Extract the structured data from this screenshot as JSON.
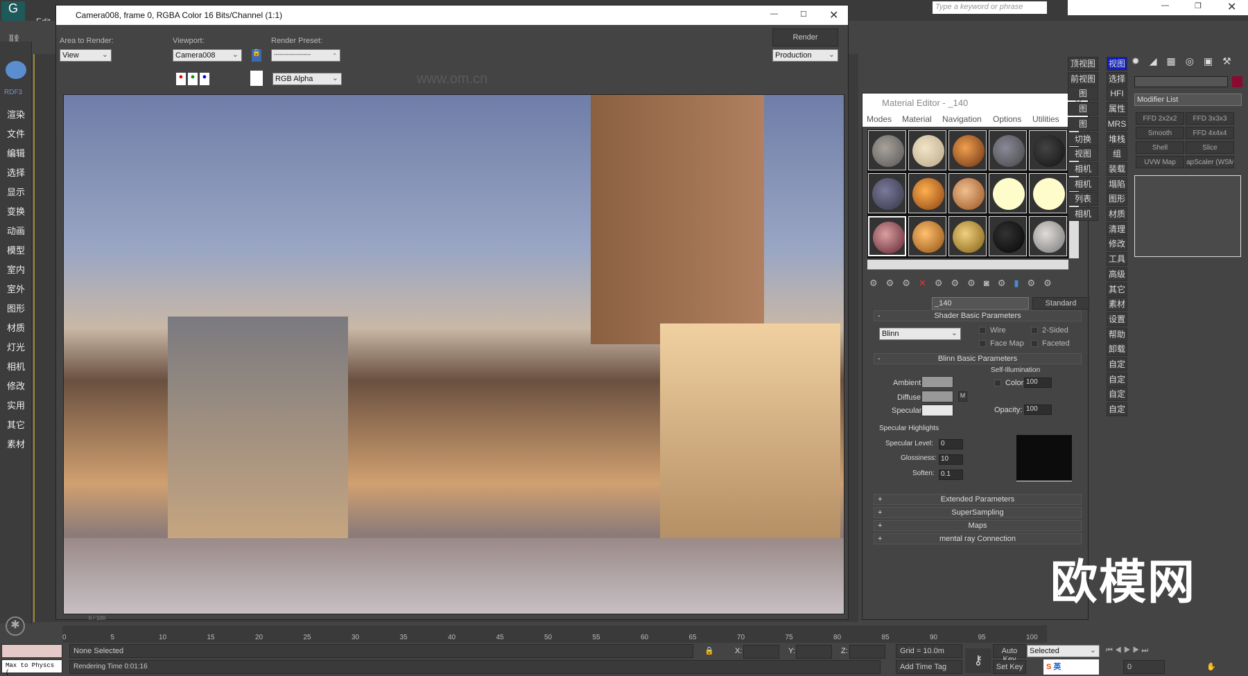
{
  "app": {
    "edit_menu": "Edit",
    "search_placeholder": "Type a keyword or phrase"
  },
  "sidebar": {
    "logo_label": "RDF3",
    "items": [
      "渲染",
      "文件",
      "编辑",
      "选择",
      "显示",
      "变换",
      "动画",
      "模型",
      "室内",
      "室外",
      "图形",
      "材质",
      "灯光",
      "相机",
      "修改",
      "实用",
      "其它",
      "素材"
    ]
  },
  "render_window": {
    "title": "Camera008, frame 0, RGBA Color 16 Bits/Channel (1:1)",
    "area_label": "Area to Render:",
    "area_value": "View",
    "viewport_label": "Viewport:",
    "viewport_value": "Camera008",
    "preset_label": "Render Preset:",
    "preset_value": "--------------------",
    "render_button": "Render",
    "mode_value": "Production",
    "channel_value": "RGB Alpha",
    "watermark": "www.om.cn"
  },
  "material_editor": {
    "title": "Material Editor - _140",
    "menus": [
      "Modes",
      "Material",
      "Navigation",
      "Options",
      "Utilities"
    ],
    "material_name": "_140",
    "material_type": "Standard",
    "shader_rollout": "Shader Basic Parameters",
    "shader_value": "Blinn",
    "checkboxes": [
      "Wire",
      "2-Sided",
      "Face Map",
      "Faceted"
    ],
    "blinn_rollout": "Blinn Basic Parameters",
    "ambient": "Ambient:",
    "diffuse": "Diffuse:",
    "specular": "Specular:",
    "map_btn": "M",
    "self_illum": "Self-Illumination",
    "color_label": "Color",
    "color_value": "100",
    "opacity_label": "Opacity:",
    "opacity_value": "100",
    "spec_highlights": "Specular Highlights",
    "spec_level_label": "Specular Level:",
    "spec_level": "0",
    "glossiness_label": "Glossiness:",
    "glossiness": "10",
    "soften_label": "Soften:",
    "soften": "0.1",
    "rollouts": [
      "Extended Parameters",
      "SuperSampling",
      "Maps",
      "mental ray Connection"
    ]
  },
  "script_cols": {
    "left": [
      "顶视图",
      "前视图",
      "图",
      "图",
      "图",
      "切换",
      "视图",
      "相机",
      "相机",
      "列表",
      "相机"
    ],
    "right": [
      "视图",
      "选择",
      "HFI",
      "属性",
      "MRS",
      "堆栈",
      "组",
      "装载",
      "塌陷",
      "图形",
      "材质",
      "清理",
      "修改",
      "工具",
      "高级",
      "其它",
      "素材",
      "设置",
      "帮助",
      "卸载",
      "自定",
      "自定",
      "自定",
      "自定"
    ]
  },
  "command_panel": {
    "modifier_list": "Modifier List",
    "accent": "#8a0a30",
    "modifiers": [
      "FFD 2x2x2",
      "FFD 3x3x3",
      "Smooth",
      "FFD 4x4x4",
      "Shell",
      "Slice",
      "UVW Map",
      "apScaler (WSM"
    ]
  },
  "timeline": {
    "frame_display": "0 / 100",
    "ticks": [
      "0",
      "5",
      "10",
      "15",
      "20",
      "25",
      "30",
      "35",
      "40",
      "45",
      "50",
      "55",
      "60",
      "65",
      "70",
      "75",
      "80",
      "85",
      "90",
      "95",
      "100"
    ]
  },
  "status": {
    "listener": "Max to Physcs (",
    "selection": "None Selected",
    "render_time": "Rendering Time  0:01:16",
    "x": "X:",
    "y": "Y:",
    "z": "Z:",
    "grid": "Grid = 10.0m",
    "add_time_tag": "Add Time Tag",
    "auto_key": "Auto Key",
    "set_key": "Set Key",
    "key_filter": "Selected",
    "frame": "0",
    "ime": "英"
  },
  "watermark": "欧模网"
}
